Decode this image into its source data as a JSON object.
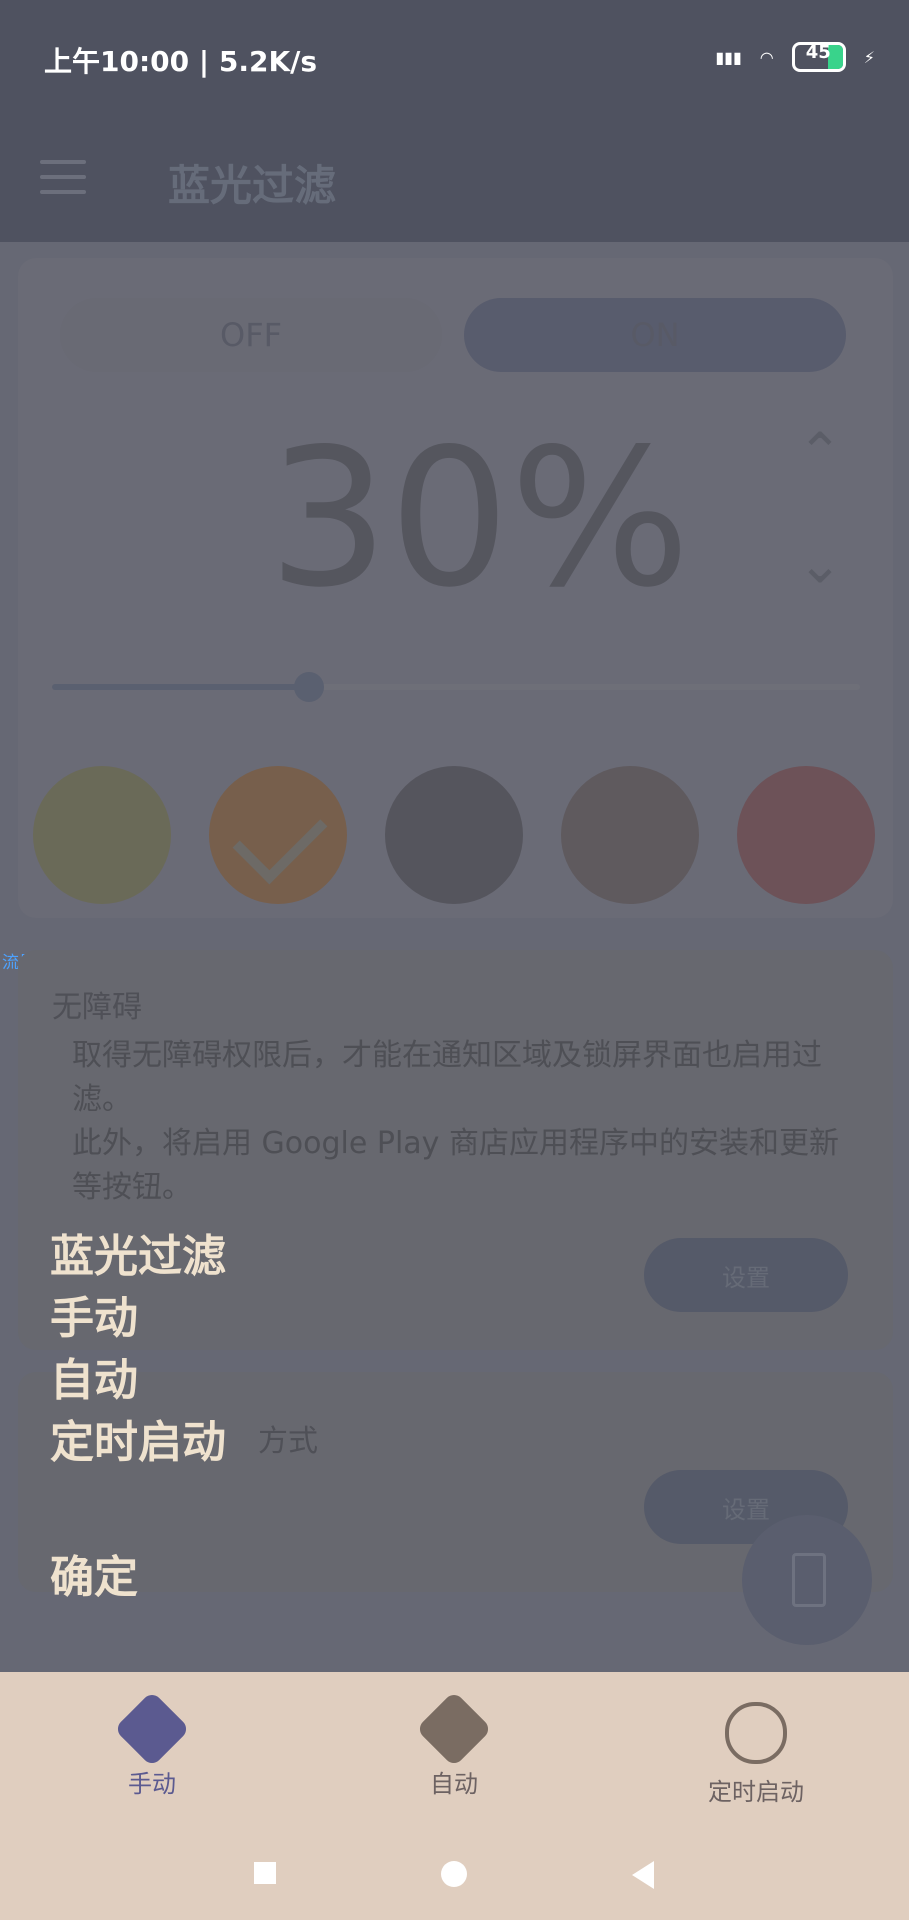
{
  "status": {
    "time_speed": "上午10:00 | 5.2K/s",
    "battery": "45"
  },
  "app": {
    "title": "蓝光过滤"
  },
  "main": {
    "off_label": "OFF",
    "on_label": "ON",
    "percent": "30%",
    "up_icon": "chevron-up-icon",
    "down_icon": "chevron-down-icon",
    "slider_value_percent": 30,
    "swatches": [
      {
        "name": "olive-swatch",
        "color": "#6a6a58"
      },
      {
        "name": "orange-swatch",
        "color": "#775f4c"
      },
      {
        "name": "gray-swatch",
        "color": "#55555d"
      },
      {
        "name": "brown-swatch",
        "color": "#5f5a5e"
      },
      {
        "name": "red-swatch",
        "color": "#6d5258"
      }
    ],
    "watermark": "流星社区"
  },
  "accessibility": {
    "title": "无障碍",
    "description_1": "取得无障碍权限后，才能在通知区域及锁屏界面也启用过滤。",
    "description_2": "此外，将启用 Google Play 商店应用程序中的安装和更新等按钮。",
    "setting_label": "设置"
  },
  "startup": {
    "title": "方式",
    "setting_label": "设置"
  },
  "overlay_menu": {
    "items": [
      "蓝光过滤",
      "手动",
      "自动",
      "定时启动"
    ],
    "confirm": "确定"
  },
  "bottom_nav": {
    "items": [
      {
        "label": "手动",
        "icon": "brightness-icon",
        "color": "#5b5a90"
      },
      {
        "label": "自动",
        "icon": "auto-brightness-icon",
        "color": "#7a6c62"
      },
      {
        "label": "定时启动",
        "icon": "alarm-icon",
        "color": "#7a6c62"
      }
    ]
  }
}
